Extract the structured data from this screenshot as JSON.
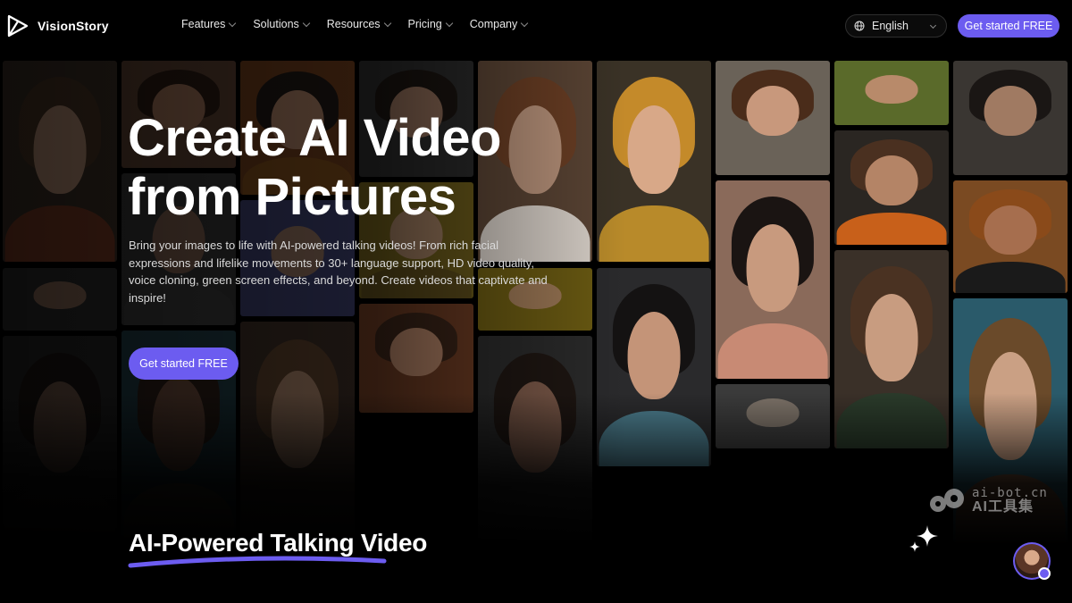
{
  "brand": {
    "name": "VisionStory"
  },
  "nav": {
    "menu": [
      {
        "label": "Features"
      },
      {
        "label": "Solutions"
      },
      {
        "label": "Resources"
      },
      {
        "label": "Pricing"
      },
      {
        "label": "Company"
      }
    ],
    "language": "English",
    "cta": "Get started FREE"
  },
  "hero": {
    "title_line1": "Create AI Video",
    "title_line2": "from Pictures",
    "description": "Bring your images to life with AI-powered talking videos! From rich facial expressions and lifelike movements to 30+ language support, HD video quality, voice cloning, green screen effects, and beyond. Create videos that captivate and inspire!",
    "cta": "Get started FREE"
  },
  "section": {
    "title_highlight": "AI-Powered Talking",
    "title_rest": " Video"
  },
  "watermark": {
    "domain": "ai-bot.cn",
    "cn": "AI工具集"
  },
  "colors": {
    "accent": "#6c5cf0",
    "background": "#000000"
  },
  "icons": [
    "logo-icon",
    "chevron-down-icon",
    "globe-icon",
    "sparkle-icon",
    "headset-icon"
  ]
}
